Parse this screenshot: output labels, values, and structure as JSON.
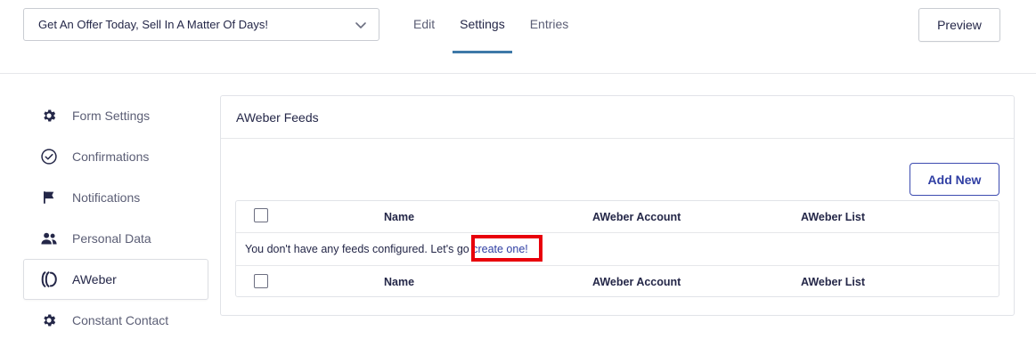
{
  "header": {
    "form_selector": {
      "value": "Get An Offer Today, Sell In A Matter Of Days!"
    },
    "tabs": [
      {
        "label": "Edit",
        "active": false
      },
      {
        "label": "Settings",
        "active": true
      },
      {
        "label": "Entries",
        "active": false
      }
    ],
    "preview_label": "Preview"
  },
  "sidebar": {
    "items": [
      {
        "label": "Form Settings",
        "icon": "gear-icon",
        "active": false
      },
      {
        "label": "Confirmations",
        "icon": "check-circle-icon",
        "active": false
      },
      {
        "label": "Notifications",
        "icon": "flag-icon",
        "active": false
      },
      {
        "label": "Personal Data",
        "icon": "users-icon",
        "active": false
      },
      {
        "label": "AWeber",
        "icon": "aweber-icon",
        "active": true
      },
      {
        "label": "Constant Contact",
        "icon": "gear-icon",
        "active": false
      }
    ]
  },
  "panel": {
    "title": "AWeber Feeds",
    "add_new_label": "Add New",
    "table": {
      "columns": [
        "Name",
        "AWeber Account",
        "AWeber List"
      ],
      "empty_text": "You don't have any feeds configured. Let's go ",
      "empty_link": "create one!"
    }
  },
  "colors": {
    "accent": "#2f3ea3",
    "tab_underline": "#3e79a8",
    "highlight": "#e8000b"
  }
}
